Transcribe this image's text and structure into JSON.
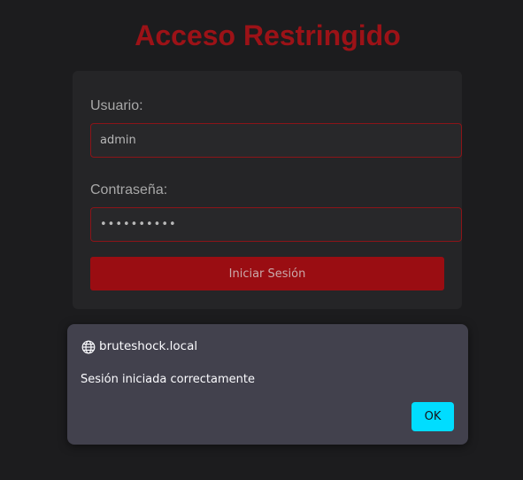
{
  "page": {
    "title": "Acceso Restringido"
  },
  "login_form": {
    "username_label": "Usuario:",
    "username_value": "admin",
    "password_label": "Contraseña:",
    "password_value": "••••••••••",
    "submit_label": "Iniciar Sesión"
  },
  "alert": {
    "origin": "bruteshock.local",
    "origin_icon": "globe-icon",
    "message": "Sesión iniciada correctamente",
    "ok_label": "OK"
  },
  "colors": {
    "background": "#1c1c1e",
    "card": "#252527",
    "title": "#9c1217",
    "field_border": "#8c1418",
    "button": "#9a0d12",
    "dialog": "#42414d",
    "dialog_button": "#00ddff"
  }
}
